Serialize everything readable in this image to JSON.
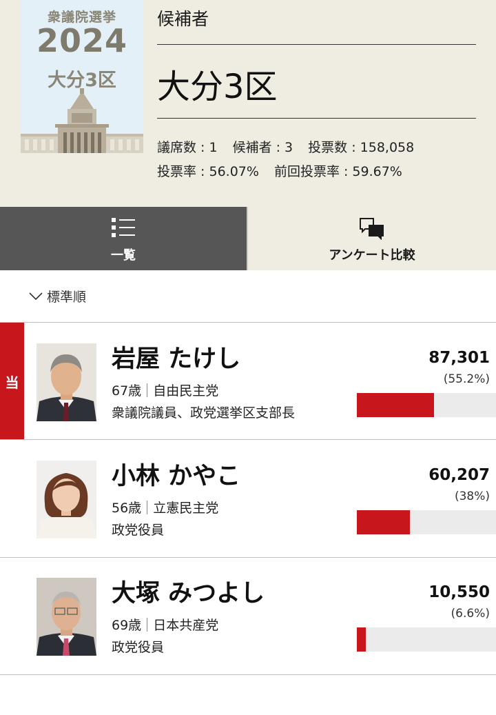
{
  "emblem": {
    "title": "衆議院選挙",
    "year": "2024",
    "district": "大分3区"
  },
  "header": {
    "label": "候補者",
    "district": "大分3区",
    "stats": {
      "seats": "議席数 : 1",
      "candidates": "候補者 : 3",
      "votes": "投票数 : 158,058",
      "turnout": "投票率 : 56.07%",
      "prev_turnout": "前回投票率 : 59.67%"
    }
  },
  "tabs": [
    {
      "label": "一覧",
      "icon": "list-icon",
      "active": true
    },
    {
      "label": "アンケート比較",
      "icon": "compare-icon",
      "active": false
    }
  ],
  "sort": {
    "label": "標準順",
    "icon": "chevron-down-icon"
  },
  "colors": {
    "accent": "#c8161d",
    "header_bg": "#efece2",
    "active_tab": "#565656"
  },
  "candidates": [
    {
      "name": "岩屋 たけし",
      "age": "67歳",
      "party": "自由民主党",
      "role": "衆議院議員、政党選挙区支部長",
      "votes": "87,301",
      "pct": "(55.2%)",
      "share": 0.552,
      "elected": true,
      "badge": "当"
    },
    {
      "name": "小林 かやこ",
      "age": "56歳",
      "party": "立憲民主党",
      "role": "政党役員",
      "votes": "60,207",
      "pct": "(38%)",
      "share": 0.38,
      "elected": false,
      "badge": ""
    },
    {
      "name": "大塚 みつよし",
      "age": "69歳",
      "party": "日本共産党",
      "role": "政党役員",
      "votes": "10,550",
      "pct": "(6.6%)",
      "share": 0.066,
      "elected": false,
      "badge": ""
    }
  ]
}
